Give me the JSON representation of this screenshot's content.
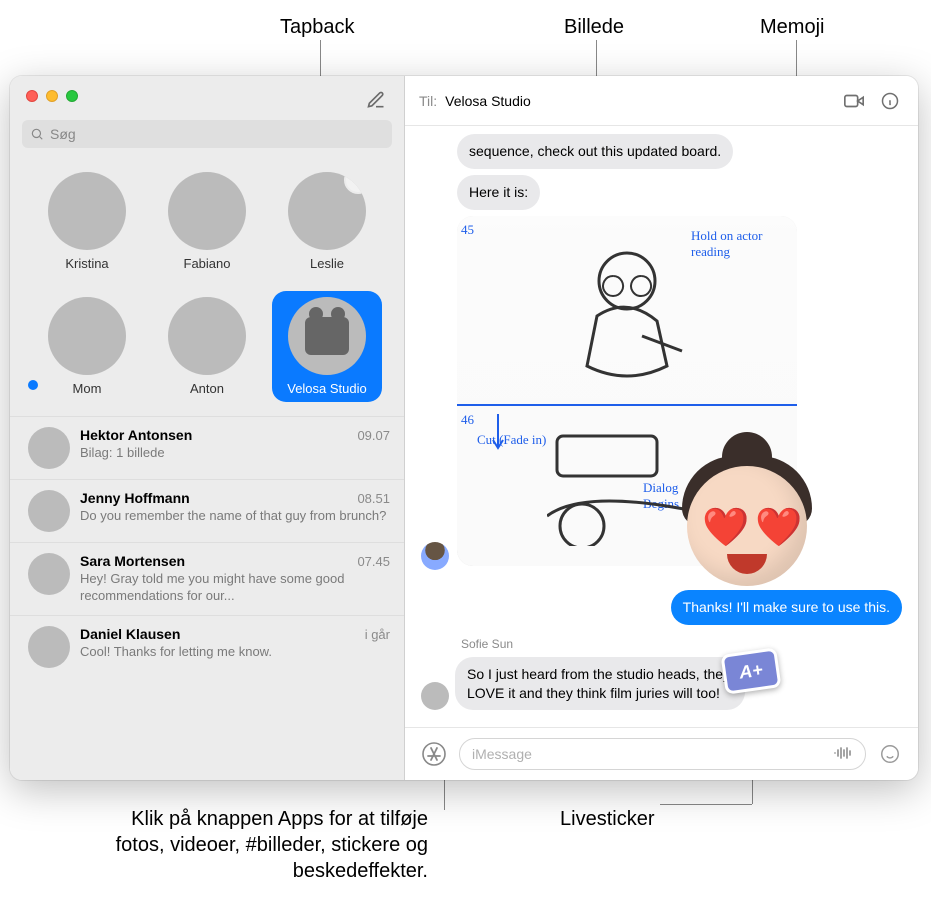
{
  "callouts": {
    "tapback": "Tapback",
    "billede": "Billede",
    "memoji": "Memoji",
    "livesticker": "Livesticker",
    "apps_caption": "Klik på knappen Apps for at tilføje fotos, videoer, #billeder, stickere og beskedeffekter."
  },
  "search": {
    "placeholder": "Søg"
  },
  "pinned": [
    {
      "name": "Kristina"
    },
    {
      "name": "Fabiano"
    },
    {
      "name": "Leslie",
      "tapback": "heart"
    },
    {
      "name": "Mom",
      "unread": true
    },
    {
      "name": "Anton"
    },
    {
      "name": "Velosa Studio",
      "selected": true
    }
  ],
  "conversations": [
    {
      "name": "Hektor Antonsen",
      "time": "09.07",
      "preview": "Bilag:  1 billede"
    },
    {
      "name": "Jenny Hoffmann",
      "time": "08.51",
      "preview": "Do you remember the name of that guy from brunch?"
    },
    {
      "name": "Sara Mortensen",
      "time": "07.45",
      "preview": "Hey! Gray told me you might have some good recommendations for our..."
    },
    {
      "name": "Daniel Klausen",
      "time": "i går",
      "preview": "Cool! Thanks for letting me know."
    }
  ],
  "header": {
    "to_label": "Til:",
    "to_name": "Velosa Studio"
  },
  "messages": {
    "m0": "sequence, check out this updated board.",
    "m1": "Here it is:",
    "out1": "Thanks! I'll make sure to use this.",
    "sender2": "Sofie Sun",
    "m2": "So I just heard from the studio heads, they LOVE it and they think film juries will too!",
    "sticker_text": "A+"
  },
  "storyboard_notes": {
    "n1": "Hold on actor reading",
    "n2": "Cut (Fade in)",
    "n3": "Dialog Begins Here",
    "s45": "45",
    "s46": "46"
  },
  "compose": {
    "placeholder": "iMessage"
  }
}
